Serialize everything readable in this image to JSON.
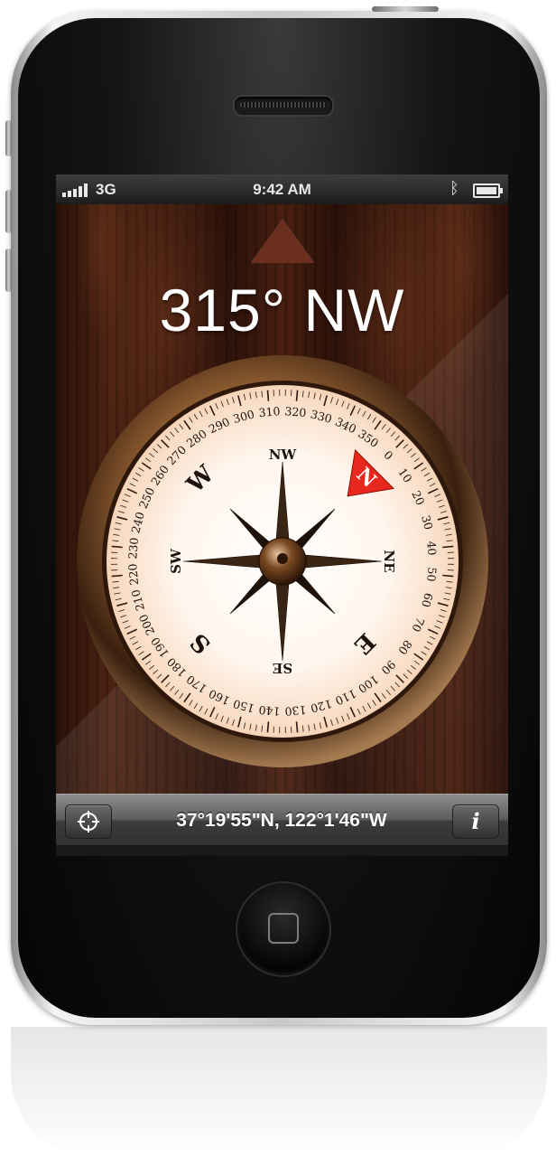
{
  "status_bar": {
    "carrier": "3G",
    "time": "9:42 AM",
    "bluetooth_icon": "bluetooth-icon",
    "battery_icon": "battery-icon",
    "signal_bars": 5
  },
  "compass": {
    "heading_text": "315° NW",
    "heading_degrees": 315,
    "north_label": "N",
    "cardinal": {
      "w": "W",
      "s": "S",
      "e": "E"
    },
    "intercardinal": {
      "nw": "NW",
      "ne": "NE",
      "sw": "SW",
      "se": "SE"
    },
    "degree_labels": [
      "0",
      "10",
      "20",
      "30",
      "40",
      "50",
      "60",
      "70",
      "80",
      "90",
      "100",
      "110",
      "120",
      "130",
      "140",
      "150",
      "160",
      "170",
      "180",
      "190",
      "200",
      "210",
      "220",
      "230",
      "240",
      "250",
      "260",
      "270",
      "280",
      "290",
      "300",
      "310",
      "320",
      "330",
      "340",
      "350"
    ],
    "accent_color": "#e8281e"
  },
  "bottom_bar": {
    "coordinates": "37°19'55\"N, 122°1'46\"W",
    "info_label": "i",
    "locate_icon": "crosshair-icon"
  }
}
